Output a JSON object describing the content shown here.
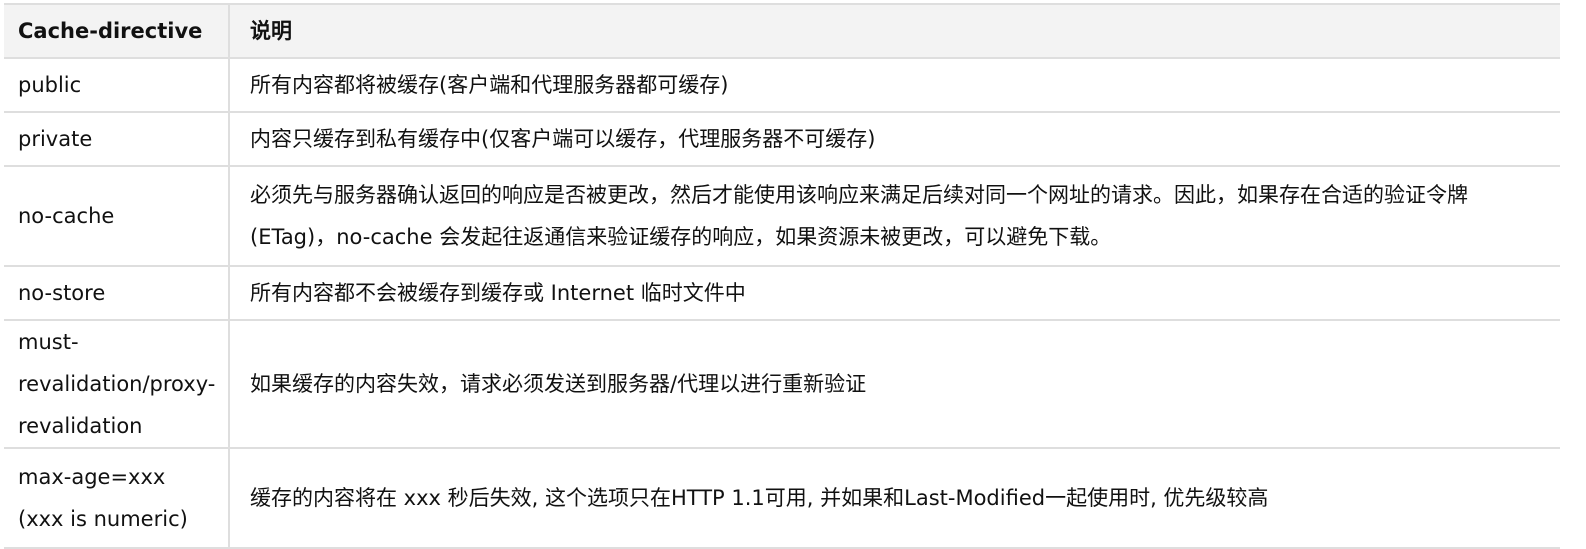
{
  "table": {
    "headers": {
      "key": "Cache-directive",
      "desc": "说明"
    },
    "rows": [
      {
        "key": "public",
        "desc": "所有内容都将被缓存(客户端和代理服务器都可缓存)"
      },
      {
        "key": "private",
        "desc": "内容只缓存到私有缓存中(仅客户端可以缓存，代理服务器不可缓存)"
      },
      {
        "key": "no-cache",
        "desc": "必须先与服务器确认返回的响应是否被更改，然后才能使用该响应来满足后续对同一个网址的请求。因此，如果存在合适的验证令牌 (ETag)，no-cache 会发起往返通信来验证缓存的响应，如果资源未被更改，可以避免下载。"
      },
      {
        "key": "no-store",
        "desc": "所有内容都不会被缓存到缓存或 Internet 临时文件中"
      },
      {
        "key": "must-revalidation/proxy-revalidation",
        "desc": "如果缓存的内容失效，请求必须发送到服务器/代理以进行重新验证"
      },
      {
        "key": "max-age=xxx (xxx is numeric)",
        "desc": "缓存的内容将在 xxx 秒后失效, 这个选项只在HTTP 1.1可用, 并如果和Last-Modified一起使用时, 优先级较高"
      }
    ]
  }
}
